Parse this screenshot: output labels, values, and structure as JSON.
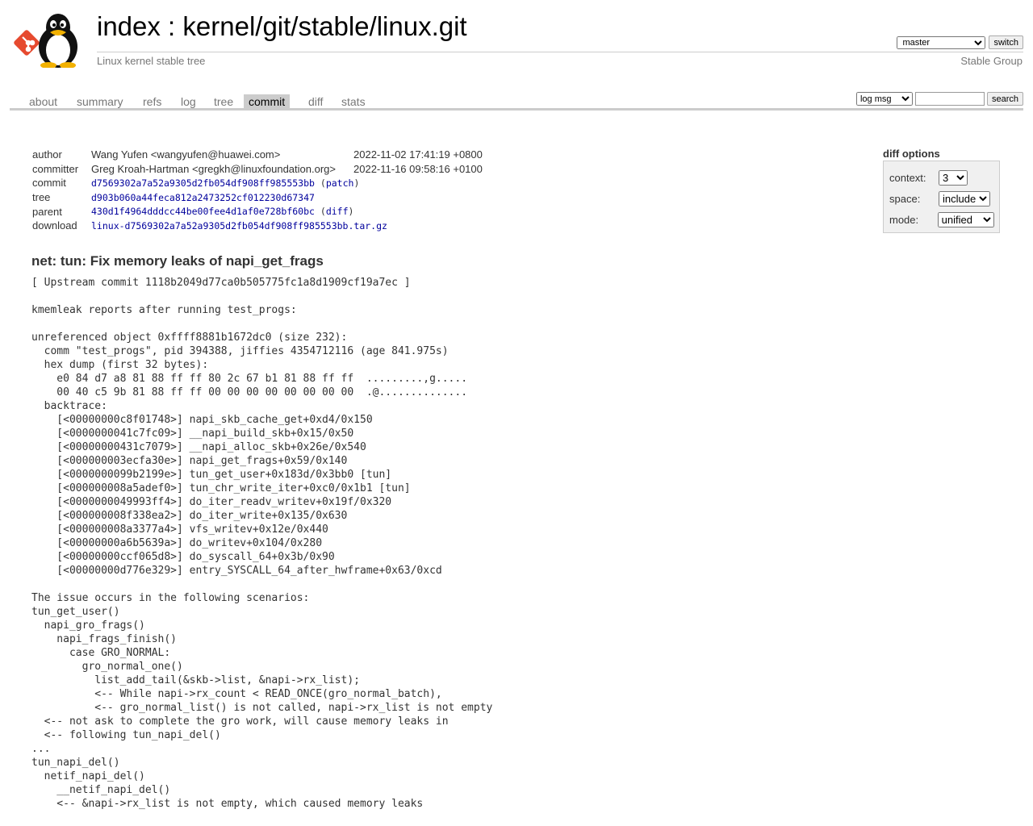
{
  "header": {
    "title_index": "index",
    "title_sep": " : ",
    "title_repo": "kernel/git/stable/linux.git",
    "subtitle": "Linux kernel stable tree",
    "owner": "Stable Group",
    "branch_selected": "master",
    "switch_label": "switch"
  },
  "tabs": [
    "about",
    "summary",
    "refs",
    "log",
    "tree",
    "commit",
    "diff",
    "stats"
  ],
  "active_tab": "commit",
  "search": {
    "mode_selected": "log msg",
    "query": "",
    "button_label": "search"
  },
  "commit_info": {
    "author_label": "author",
    "author": "Wang Yufen <wangyufen@huawei.com>",
    "author_date": "2022-11-02 17:41:19 +0800",
    "committer_label": "committer",
    "committer": "Greg Kroah-Hartman <gregkh@linuxfoundation.org>",
    "committer_date": "2022-11-16 09:58:16 +0100",
    "commit_label": "commit",
    "commit": "d7569302a7a52a9305d2fb054df908ff985553bb",
    "patch_link": "patch",
    "tree_label": "tree",
    "tree": "d903b060a44feca812a2473252cf012230d67347",
    "parent_label": "parent",
    "parent": "430d1f4964dddcc44be00fee4d1af0e728bf60bc",
    "diff_link": "diff",
    "download_label": "download",
    "download": "linux-d7569302a7a52a9305d2fb054df908ff985553bb.tar.gz"
  },
  "diff_options": {
    "title": "diff options",
    "context_label": "context:",
    "context_value": "3",
    "space_label": "space:",
    "space_value": "include",
    "mode_label": "mode:",
    "mode_value": "unified"
  },
  "subject": "net: tun: Fix memory leaks of napi_get_frags",
  "message": "[ Upstream commit 1118b2049d77ca0b505775fc1a8d1909cf19a7ec ]\n\nkmemleak reports after running test_progs:\n\nunreferenced object 0xffff8881b1672dc0 (size 232):\n  comm \"test_progs\", pid 394388, jiffies 4354712116 (age 841.975s)\n  hex dump (first 32 bytes):\n    e0 84 d7 a8 81 88 ff ff 80 2c 67 b1 81 88 ff ff  .........,g.....\n    00 40 c5 9b 81 88 ff ff 00 00 00 00 00 00 00 00  .@..............\n  backtrace:\n    [<00000000c8f01748>] napi_skb_cache_get+0xd4/0x150\n    [<0000000041c7fc09>] __napi_build_skb+0x15/0x50\n    [<00000000431c7079>] __napi_alloc_skb+0x26e/0x540\n    [<000000003ecfa30e>] napi_get_frags+0x59/0x140\n    [<0000000099b2199e>] tun_get_user+0x183d/0x3bb0 [tun]\n    [<000000008a5adef0>] tun_chr_write_iter+0xc0/0x1b1 [tun]\n    [<0000000049993ff4>] do_iter_readv_writev+0x19f/0x320\n    [<000000008f338ea2>] do_iter_write+0x135/0x630\n    [<000000008a3377a4>] vfs_writev+0x12e/0x440\n    [<00000000a6b5639a>] do_writev+0x104/0x280\n    [<00000000ccf065d8>] do_syscall_64+0x3b/0x90\n    [<00000000d776e329>] entry_SYSCALL_64_after_hwframe+0x63/0xcd\n\nThe issue occurs in the following scenarios:\ntun_get_user()\n  napi_gro_frags()\n    napi_frags_finish()\n      case GRO_NORMAL:\n        gro_normal_one()\n          list_add_tail(&skb->list, &napi->rx_list);\n          <-- While napi->rx_count < READ_ONCE(gro_normal_batch),\n          <-- gro_normal_list() is not called, napi->rx_list is not empty\n  <-- not ask to complete the gro work, will cause memory leaks in\n  <-- following tun_napi_del()\n...\ntun_napi_del()\n  netif_napi_del()\n    __netif_napi_del()\n    <-- &napi->rx_list is not empty, which caused memory leaks",
  "colors": {
    "link": "#00009c",
    "tab_active_bg": "#cccccc",
    "tab_text": "#777777",
    "git_logo": "#e64a2f"
  }
}
